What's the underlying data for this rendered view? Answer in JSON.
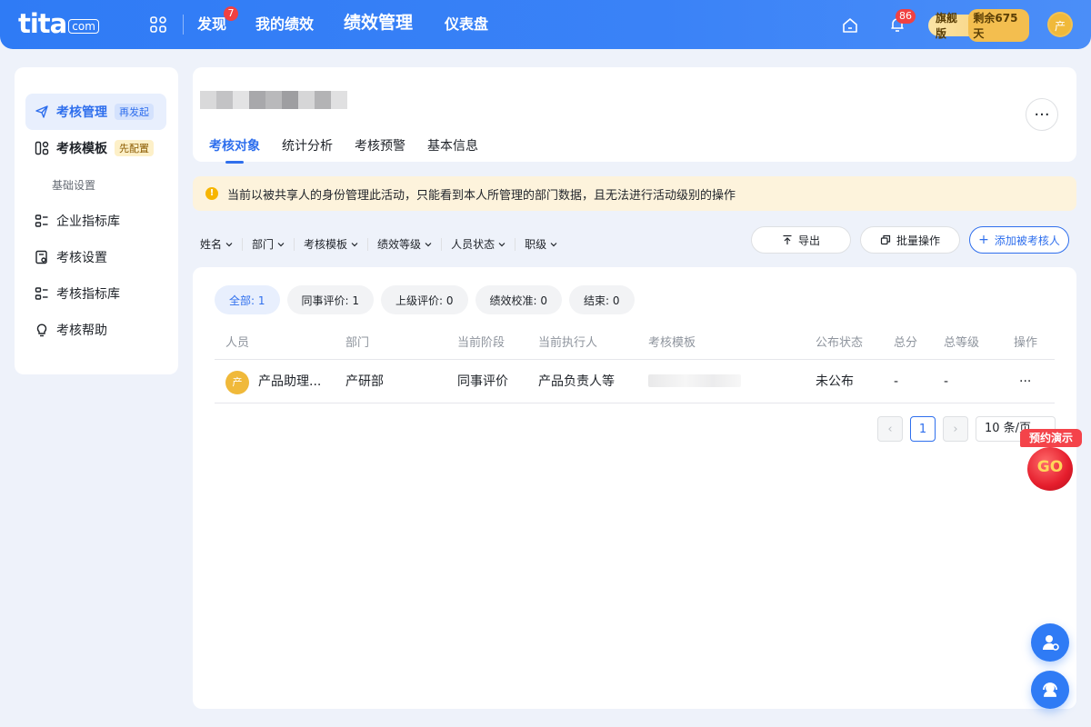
{
  "header": {
    "logo_text": "tita",
    "logo_suffix": "com",
    "nav": [
      {
        "label": "发现",
        "badge": "7"
      },
      {
        "label": "我的绩效"
      },
      {
        "label": "绩效管理",
        "active": true
      },
      {
        "label": "仪表盘"
      }
    ],
    "notification_count": "86",
    "plan_label": "旗舰版",
    "plan_remaining": "剩余675天",
    "user_avatar": "产"
  },
  "sidebar": {
    "items": [
      {
        "label": "考核管理",
        "tag": "再发起",
        "icon": "send-icon",
        "active": true
      },
      {
        "label": "考核模板",
        "tag": "先配置",
        "icon": "template-icon"
      }
    ],
    "group_title": "基础设置",
    "settings": [
      {
        "label": "企业指标库",
        "icon": "list-icon"
      },
      {
        "label": "考核设置",
        "icon": "settings-doc-icon"
      },
      {
        "label": "考核指标库",
        "icon": "list-icon"
      },
      {
        "label": "考核帮助",
        "icon": "lightbulb-icon"
      }
    ]
  },
  "page": {
    "tabs": [
      "考核对象",
      "统计分析",
      "考核预警",
      "基本信息"
    ],
    "active_tab": "考核对象",
    "more_label": "···"
  },
  "notice": {
    "text": "当前以被共享人的身份管理此活动，只能看到本人所管理的部门数据，且无法进行活动级别的操作"
  },
  "filters": [
    "姓名",
    "部门",
    "考核模板",
    "绩效等级",
    "人员状态",
    "职级"
  ],
  "actions": {
    "export": "导出",
    "batch": "批量操作",
    "add": "添加被考核人"
  },
  "status_pills": [
    {
      "label": "全部: 1",
      "active": true
    },
    {
      "label": "同事评价: 1"
    },
    {
      "label": "上级评价: 0"
    },
    {
      "label": "绩效校准: 0"
    },
    {
      "label": "结束: 0"
    }
  ],
  "table": {
    "columns": [
      "人员",
      "部门",
      "当前阶段",
      "当前执行人",
      "考核模板",
      "公布状态",
      "总分",
      "总等级",
      "操作"
    ],
    "rows": [
      {
        "avatar": "产",
        "person": "产品助理...",
        "department": "产研部",
        "stage": "同事评价",
        "executor": "产品负责人等",
        "template": "",
        "publish_status": "未公布",
        "total_score": "-",
        "total_grade": "-",
        "action": "···"
      }
    ]
  },
  "pagination": {
    "current_page": "1",
    "page_size": "10 条/页"
  },
  "float": {
    "demo_label": "预约演示",
    "go_label": "GO"
  }
}
